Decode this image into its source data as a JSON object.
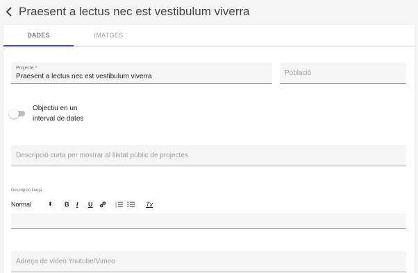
{
  "page": {
    "title": "Praesent a lectus nec est vestibulum viverra"
  },
  "tabs": [
    {
      "label": "DADES",
      "active": true
    },
    {
      "label": "IMATGES",
      "active": false
    }
  ],
  "form": {
    "projecte": {
      "label": "Projecte *",
      "value": "Praesent a lectus nec est vestibulum viverra"
    },
    "poblacio": {
      "placeholder": "Població"
    },
    "toggle": {
      "label_line1": "Objectiu en un",
      "label_line2": "interval de dates",
      "checked": false
    },
    "descripcio_curta": {
      "placeholder": "Descripció curta per mostrar al llistat públic de projectes"
    },
    "descripcio_llarga": {
      "label": "Descripció llarga",
      "toolbar": {
        "format": "Normal",
        "format_arrow": "⬍",
        "bold": "B",
        "italic": "I",
        "underline": "U",
        "link_icon": "link-icon",
        "ordered_list_icon": "ordered-list-icon",
        "bullet_list_icon": "bullet-list-icon",
        "clear_format": "Tx"
      },
      "value": ""
    },
    "video": {
      "placeholder": "Adreça de vídeo Youtube/Vimeo"
    }
  },
  "colors": {
    "accent": "#3f51b5",
    "field_bg": "#f5f5f5",
    "page_bg": "#f5f5f5"
  }
}
